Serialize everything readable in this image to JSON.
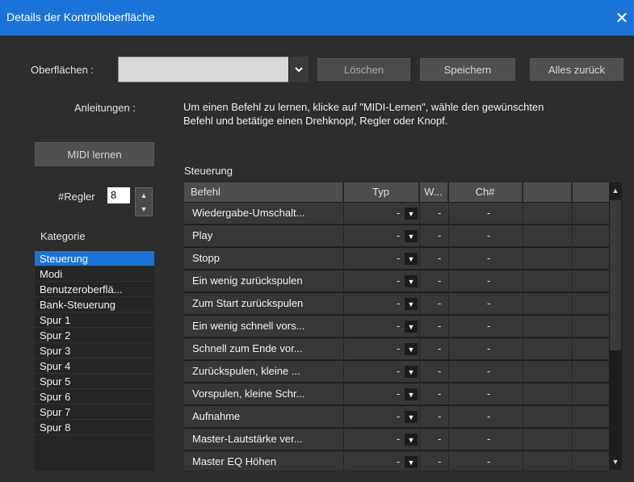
{
  "window": {
    "title": "Details der Kontrolloberfläche",
    "close_glyph": "✕"
  },
  "surfaces": {
    "label": "Oberflächen :",
    "value": "",
    "delete_label": "Löschen",
    "save_label": "Speichern",
    "reset_label": "Alles zurück"
  },
  "instructions": {
    "label": "Anleitungen :",
    "text": "Um einen Befehl zu lernen, klicke auf \"MIDI-Lernen\", wähle den gewünschten Befehl und betätige einen Drehknopf, Regler oder Knopf."
  },
  "midi_learn_label": "MIDI lernen",
  "regler": {
    "label": "#Regler",
    "value": "8"
  },
  "category": {
    "label": "Kategorie",
    "items": [
      "Steuerung",
      "Modi",
      "Benutzeroberflä...",
      "Bank-Steuerung",
      "Spur 1",
      "Spur 2",
      "Spur 3",
      "Spur 4",
      "Spur 5",
      "Spur 6",
      "Spur 7",
      "Spur 8"
    ],
    "selected_index": 0
  },
  "table": {
    "title": "Steuerung",
    "headers": [
      "Befehl",
      "Typ",
      "W...",
      "Ch#",
      "",
      ""
    ],
    "rows": [
      {
        "cmd": "Wiedergabe-Umschalt...",
        "typ": "-",
        "w": "-",
        "ch": "-"
      },
      {
        "cmd": "Play",
        "typ": "-",
        "w": "-",
        "ch": "-"
      },
      {
        "cmd": "Stopp",
        "typ": "-",
        "w": "-",
        "ch": "-"
      },
      {
        "cmd": "Ein wenig zurückspulen",
        "typ": "-",
        "w": "-",
        "ch": "-"
      },
      {
        "cmd": "Zum Start zurückspulen",
        "typ": "-",
        "w": "-",
        "ch": "-"
      },
      {
        "cmd": "Ein wenig schnell vors...",
        "typ": "-",
        "w": "-",
        "ch": "-"
      },
      {
        "cmd": "Schnell zum Ende vor...",
        "typ": "-",
        "w": "-",
        "ch": "-"
      },
      {
        "cmd": "Zurückspulen, kleine ...",
        "typ": "-",
        "w": "-",
        "ch": "-"
      },
      {
        "cmd": "Vorspulen, kleine Schr...",
        "typ": "-",
        "w": "-",
        "ch": "-"
      },
      {
        "cmd": "Aufnahme",
        "typ": "-",
        "w": "-",
        "ch": "-"
      },
      {
        "cmd": "Master-Lautstärke ver...",
        "typ": "-",
        "w": "-",
        "ch": "-"
      },
      {
        "cmd": "Master EQ Höhen",
        "typ": "-",
        "w": "-",
        "ch": "-"
      }
    ]
  },
  "colors": {
    "accent": "#1a73d9",
    "background": "#2d2d2d"
  },
  "icons": {
    "dropdown": "chevron-down-icon",
    "close": "close-icon",
    "spinner_up": "chevron-up-icon",
    "spinner_down": "chevron-down-icon"
  }
}
